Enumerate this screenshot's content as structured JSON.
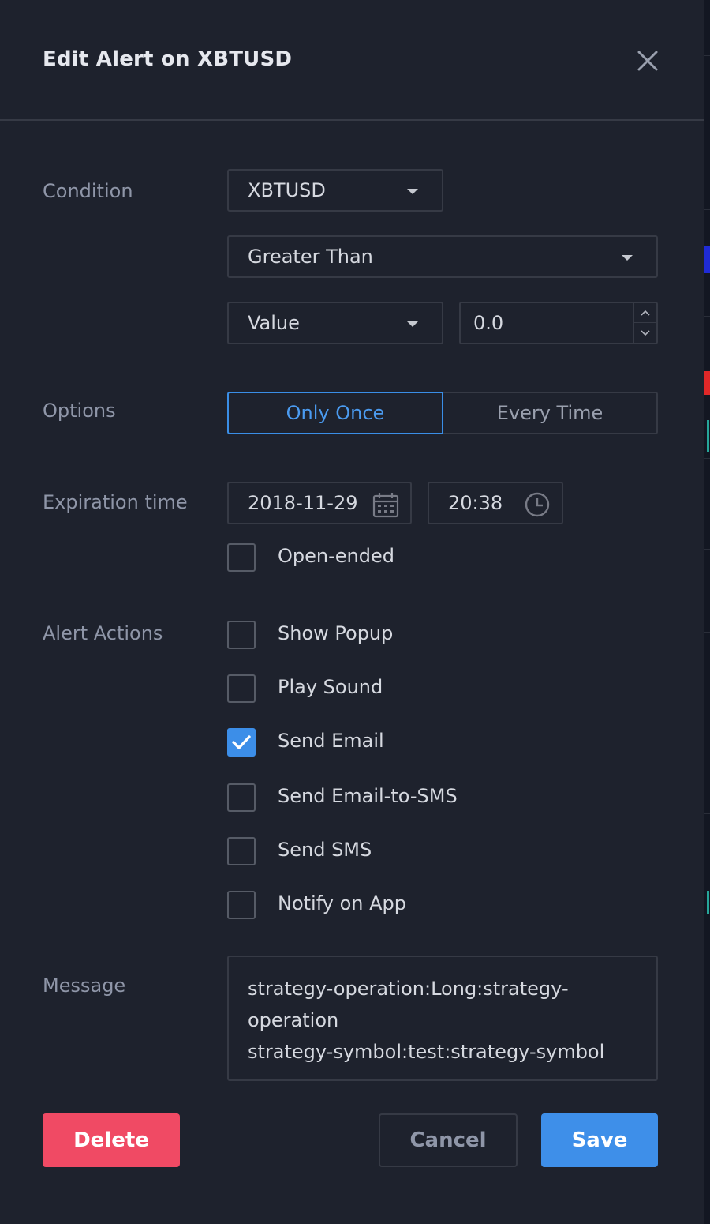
{
  "dialog": {
    "title": "Edit Alert on XBTUSD"
  },
  "condition": {
    "label": "Condition",
    "symbol": "XBTUSD",
    "operator": "Greater Than",
    "source": "Value",
    "value": "0.0"
  },
  "options": {
    "label": "Options",
    "only_once": "Only Once",
    "every_time": "Every Time",
    "selected": "Only Once"
  },
  "expiration": {
    "label": "Expiration time",
    "date": "2018-11-29",
    "time": "20:38",
    "open_ended_label": "Open-ended",
    "open_ended_checked": false
  },
  "alert_actions": {
    "label": "Alert Actions",
    "items": [
      {
        "label": "Show Popup",
        "checked": false
      },
      {
        "label": "Play Sound",
        "checked": false
      },
      {
        "label": "Send Email",
        "checked": true
      },
      {
        "label": "Send Email-to-SMS",
        "checked": false
      },
      {
        "label": "Send SMS",
        "checked": false
      },
      {
        "label": "Notify on App",
        "checked": false
      }
    ]
  },
  "message": {
    "label": "Message",
    "line1": "strategy-operation:Long:strategy-",
    "line2": "operation",
    "line3": "strategy-symbol:test:strategy-symbol"
  },
  "buttons": {
    "delete": "Delete",
    "cancel": "Cancel",
    "save": "Save"
  },
  "colors": {
    "background": "#1e222d",
    "accent": "#3e8fe9",
    "danger": "#f04a64",
    "border": "#363a45"
  },
  "icons": [
    "close-icon",
    "chevron-down-icon",
    "calendar-icon",
    "clock-icon",
    "check-icon",
    "chevron-up-icon"
  ]
}
